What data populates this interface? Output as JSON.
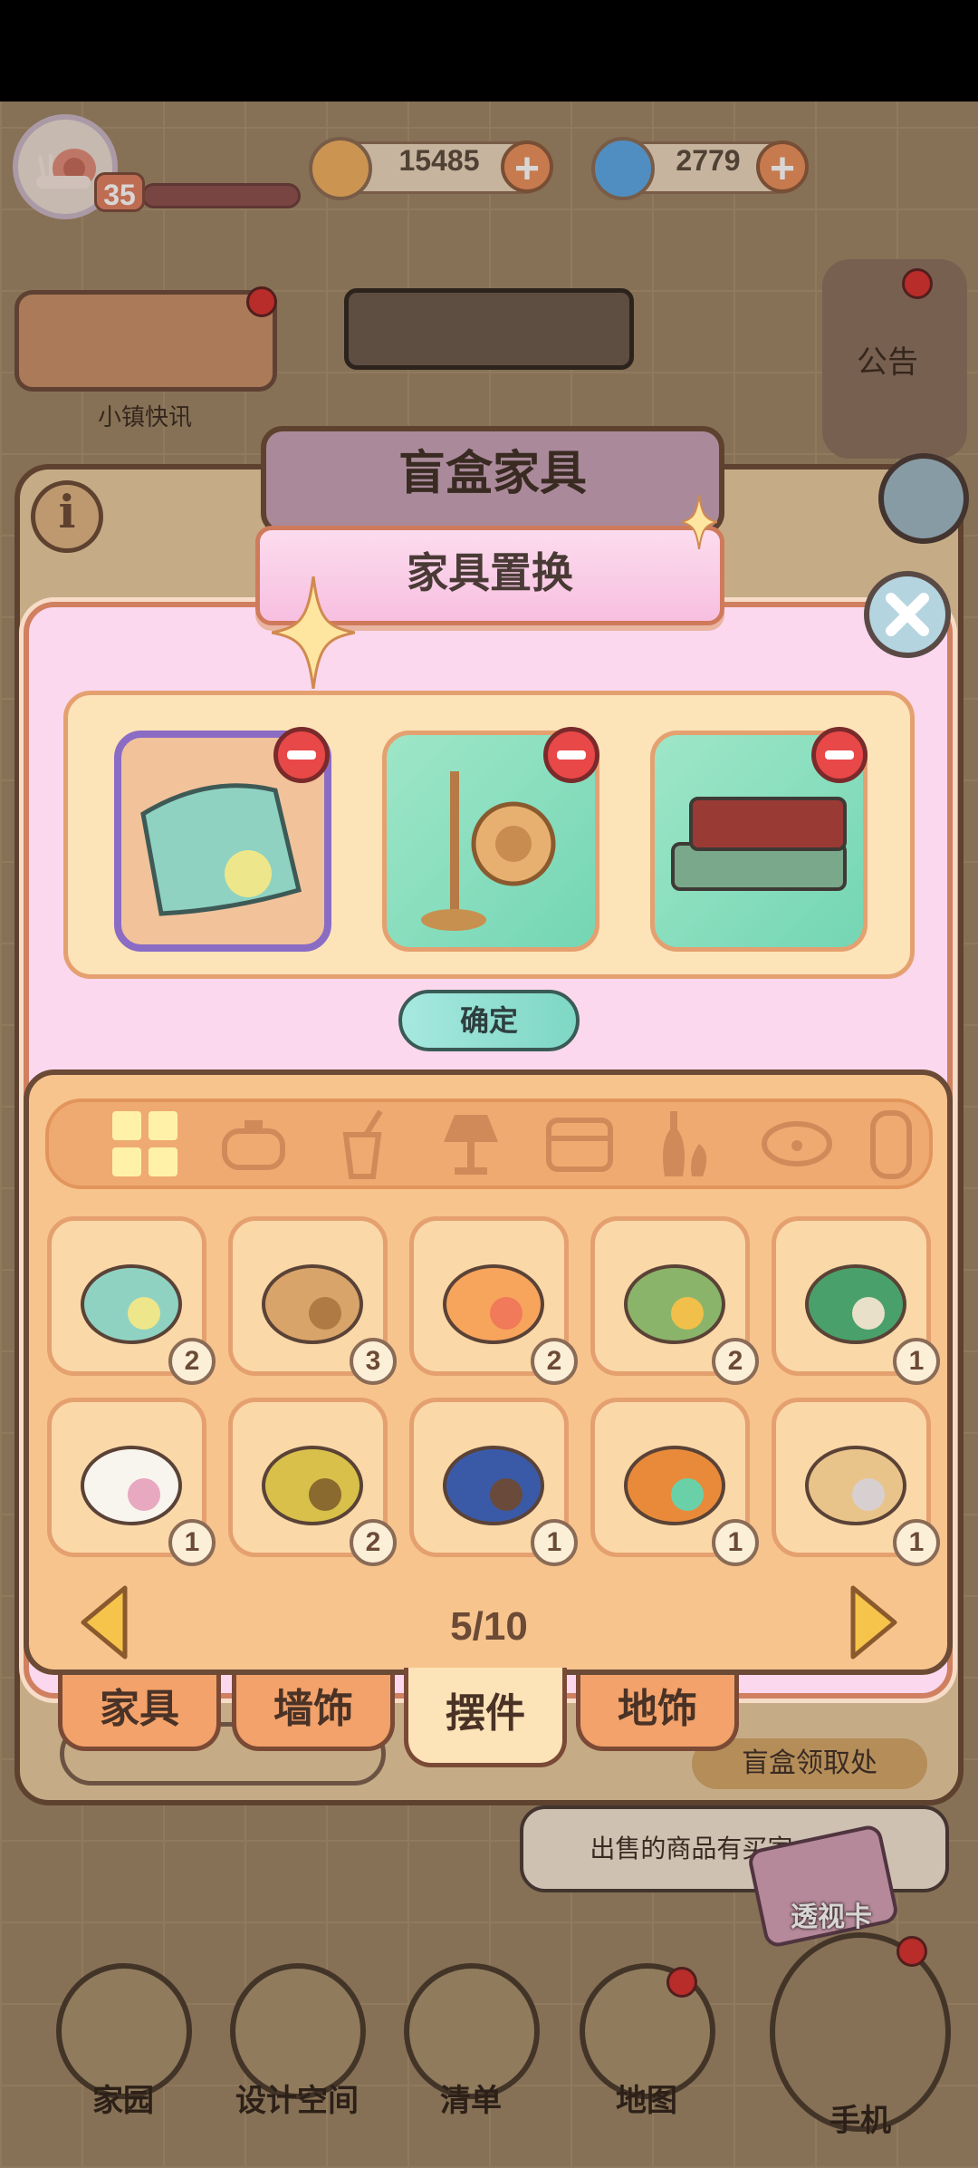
{
  "hud": {
    "level": "35",
    "currencies": [
      {
        "name": "coin",
        "amount": "15485",
        "color": "#f0b060"
      },
      {
        "name": "gem",
        "amount": "2779",
        "color": "#5aa8e8"
      }
    ]
  },
  "background": {
    "news_label": "小镇快讯",
    "notice_label": "公告",
    "blind_box_title": "盲盒家具",
    "blindbox_pickup": "盲盒领取处",
    "tip": "出售的商品有买家",
    "tip_suffix": "!",
    "lens_card": "透视卡",
    "nav": [
      {
        "label": "家园"
      },
      {
        "label": "设计空间"
      },
      {
        "label": "清单"
      },
      {
        "label": "地图"
      },
      {
        "label": "手机"
      }
    ]
  },
  "dialog": {
    "title": "家具置换",
    "confirm": "确定",
    "page": "5/10",
    "selected": [
      "mint-pillow",
      "snail-coat-rack",
      "book-stack"
    ],
    "categories": [
      "all",
      "pot",
      "cup",
      "lamp",
      "bed",
      "vase",
      "pet-bowl",
      "roll"
    ],
    "items": [
      {
        "name": "mint-pillow",
        "count": "2"
      },
      {
        "name": "cardboard-box",
        "count": "3"
      },
      {
        "name": "orange-pillow",
        "count": "2"
      },
      {
        "name": "corn",
        "count": "2"
      },
      {
        "name": "drink-can",
        "count": "1"
      },
      {
        "name": "milk-bowl",
        "count": "1"
      },
      {
        "name": "flower-pot",
        "count": "2"
      },
      {
        "name": "quill-book",
        "count": "1"
      },
      {
        "name": "orange-jar",
        "count": "1"
      },
      {
        "name": "table-lamp",
        "count": "1"
      }
    ],
    "tabs": [
      {
        "label": "家具",
        "active": false
      },
      {
        "label": "墙饰",
        "active": false
      },
      {
        "label": "摆件",
        "active": true
      },
      {
        "label": "地饰",
        "active": false
      }
    ]
  }
}
